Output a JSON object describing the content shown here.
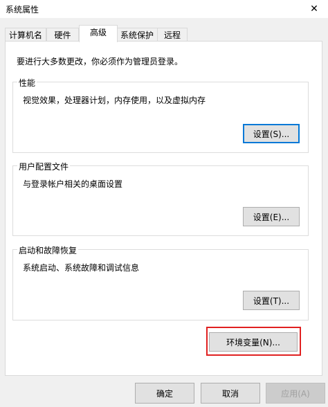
{
  "window": {
    "title": "系统属性",
    "close_glyph": "✕"
  },
  "tabs": [
    {
      "label": "计算机名",
      "active": false
    },
    {
      "label": "硬件",
      "active": false
    },
    {
      "label": "高级",
      "active": true
    },
    {
      "label": "系统保护",
      "active": false
    },
    {
      "label": "远程",
      "active": false
    }
  ],
  "admin_note": "要进行大多数更改，你必须作为管理员登录。",
  "performance": {
    "title": "性能",
    "description": "视觉效果，处理器计划，内存使用，以及虚拟内存",
    "button": "设置(S)..."
  },
  "user_profiles": {
    "title": "用户配置文件",
    "description": "与登录帐户相关的桌面设置",
    "button": "设置(E)..."
  },
  "startup_recovery": {
    "title": "启动和故障恢复",
    "description": "系统启动、系统故障和调试信息",
    "button": "设置(T)..."
  },
  "env_vars_button": "环境变量(N)...",
  "footer": {
    "ok": "确定",
    "cancel": "取消",
    "apply": "应用(A)"
  },
  "colors": {
    "highlight": "#e02020",
    "focus": "#0078d7"
  }
}
